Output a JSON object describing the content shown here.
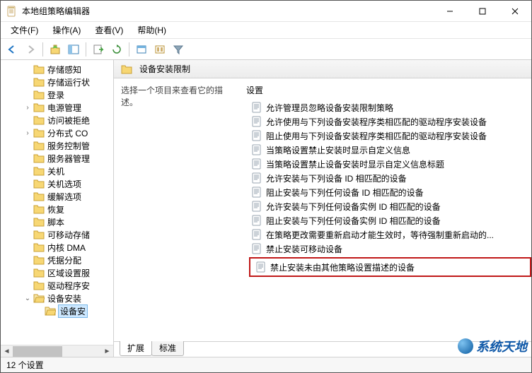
{
  "window": {
    "title": "本地组策略编辑器"
  },
  "menu": {
    "file": "文件(F)",
    "action": "操作(A)",
    "view": "查看(V)",
    "help": "帮助(H)"
  },
  "tree": {
    "items": [
      {
        "label": "存储感知",
        "indent": 0,
        "twisty": ""
      },
      {
        "label": "存储运行状",
        "indent": 0,
        "twisty": ""
      },
      {
        "label": "登录",
        "indent": 0,
        "twisty": ""
      },
      {
        "label": "电源管理",
        "indent": 0,
        "twisty": ">"
      },
      {
        "label": "访问被拒绝",
        "indent": 0,
        "twisty": ""
      },
      {
        "label": "分布式 CO",
        "indent": 0,
        "twisty": ">"
      },
      {
        "label": "服务控制管",
        "indent": 0,
        "twisty": ""
      },
      {
        "label": "服务器管理",
        "indent": 0,
        "twisty": ""
      },
      {
        "label": "关机",
        "indent": 0,
        "twisty": ""
      },
      {
        "label": "关机选项",
        "indent": 0,
        "twisty": ""
      },
      {
        "label": "缓解选项",
        "indent": 0,
        "twisty": ""
      },
      {
        "label": "恢复",
        "indent": 0,
        "twisty": ""
      },
      {
        "label": "脚本",
        "indent": 0,
        "twisty": ""
      },
      {
        "label": "可移动存储",
        "indent": 0,
        "twisty": ""
      },
      {
        "label": "内核 DMA",
        "indent": 0,
        "twisty": ""
      },
      {
        "label": "凭据分配",
        "indent": 0,
        "twisty": ""
      },
      {
        "label": "区域设置服",
        "indent": 0,
        "twisty": ""
      },
      {
        "label": "驱动程序安",
        "indent": 0,
        "twisty": ""
      },
      {
        "label": "设备安装",
        "indent": 0,
        "twisty": "v",
        "expanded": true
      },
      {
        "label": "设备安",
        "indent": 1,
        "twisty": "",
        "selected": true
      }
    ]
  },
  "detail": {
    "header_title": "设备安装限制",
    "desc_heading": "选择一个项目来查看它的描述。",
    "settings_header": "设置",
    "items": [
      "允许管理员忽略设备安装限制策略",
      "允许使用与下列设备安装程序类相匹配的驱动程序安装设备",
      "阻止使用与下列设备安装程序类相匹配的驱动程序安装设备",
      "当策略设置禁止安装时显示自定义信息",
      "当策略设置禁止设备安装时显示自定义信息标题",
      "允许安装与下列设备 ID 相匹配的设备",
      "阻止安装与下列任何设备 ID 相匹配的设备",
      "允许安装与下列任何设备实例 ID 相匹配的设备",
      "阻止安装与下列任何设备实例 ID 相匹配的设备",
      "在策略更改需要重新启动才能生效时，等待强制重新启动的...",
      "禁止安装可移动设备"
    ],
    "highlighted_item": "禁止安装未由其他策略设置描述的设备"
  },
  "tabs": {
    "extended": "扩展",
    "standard": "标准"
  },
  "statusbar": {
    "count_text": "12 个设置"
  },
  "watermark": {
    "text": "系统天地"
  }
}
